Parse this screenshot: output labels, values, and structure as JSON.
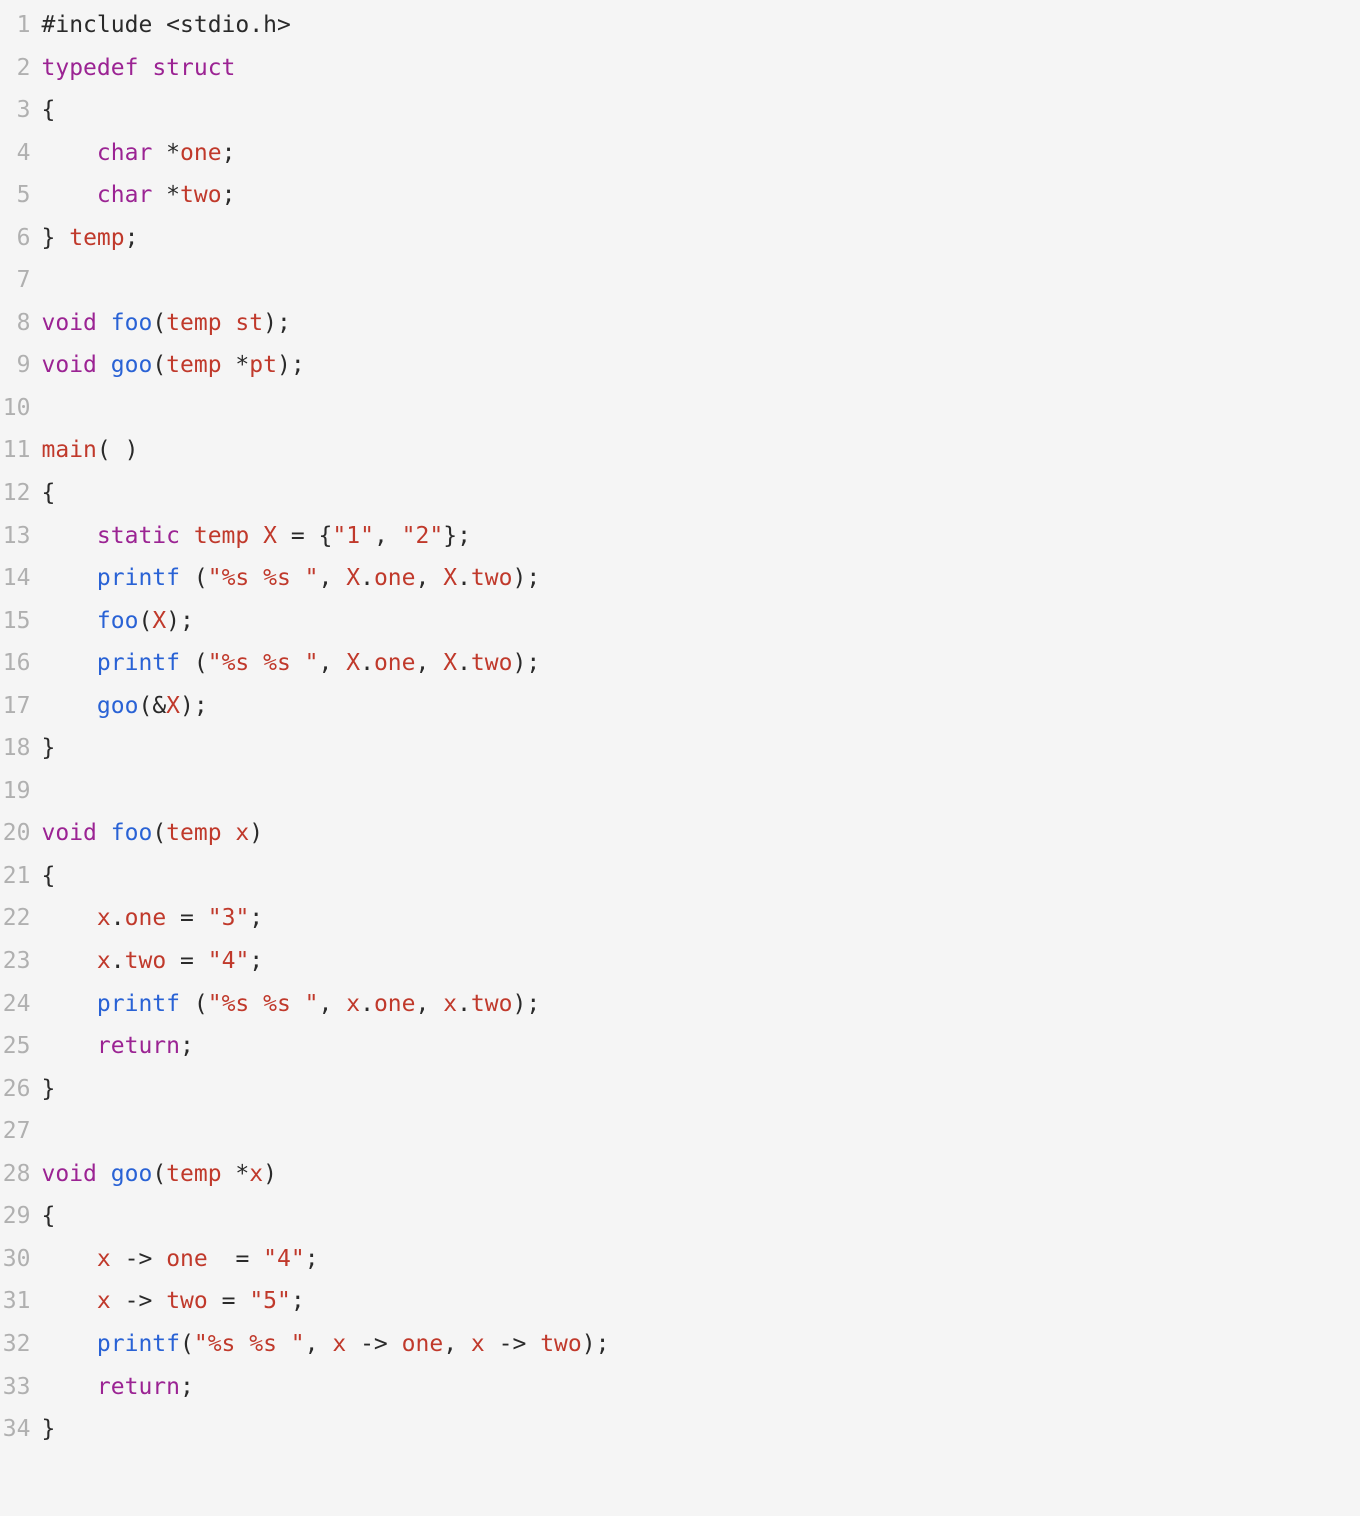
{
  "code": {
    "lines": [
      {
        "n": "1",
        "t": [
          [
            "preproc",
            "#include "
          ],
          [
            "op",
            "<"
          ],
          [
            "plain",
            "stdio.h"
          ],
          [
            "op",
            ">"
          ]
        ]
      },
      {
        "n": "2",
        "t": [
          [
            "keyword",
            "typedef"
          ],
          [
            "plain",
            " "
          ],
          [
            "keyword",
            "struct"
          ]
        ]
      },
      {
        "n": "3",
        "t": [
          [
            "op",
            "{"
          ]
        ]
      },
      {
        "n": "4",
        "t": [
          [
            "plain",
            "    "
          ],
          [
            "keyword",
            "char"
          ],
          [
            "plain",
            " "
          ],
          [
            "op",
            "*"
          ],
          [
            "ident",
            "one"
          ],
          [
            "op",
            ";"
          ]
        ]
      },
      {
        "n": "5",
        "t": [
          [
            "plain",
            "    "
          ],
          [
            "keyword",
            "char"
          ],
          [
            "plain",
            " "
          ],
          [
            "op",
            "*"
          ],
          [
            "ident",
            "two"
          ],
          [
            "op",
            ";"
          ]
        ]
      },
      {
        "n": "6",
        "t": [
          [
            "op",
            "}"
          ],
          [
            "plain",
            " "
          ],
          [
            "typename",
            "temp"
          ],
          [
            "op",
            ";"
          ]
        ]
      },
      {
        "n": "7",
        "t": []
      },
      {
        "n": "8",
        "t": [
          [
            "keyword",
            "void"
          ],
          [
            "plain",
            " "
          ],
          [
            "func",
            "foo"
          ],
          [
            "op",
            "("
          ],
          [
            "typename",
            "temp"
          ],
          [
            "plain",
            " "
          ],
          [
            "ident",
            "st"
          ],
          [
            "op",
            ");"
          ]
        ]
      },
      {
        "n": "9",
        "t": [
          [
            "keyword",
            "void"
          ],
          [
            "plain",
            " "
          ],
          [
            "func",
            "goo"
          ],
          [
            "op",
            "("
          ],
          [
            "typename",
            "temp"
          ],
          [
            "plain",
            " "
          ],
          [
            "op",
            "*"
          ],
          [
            "ident",
            "pt"
          ],
          [
            "op",
            ");"
          ]
        ]
      },
      {
        "n": "10",
        "t": []
      },
      {
        "n": "11",
        "t": [
          [
            "typename",
            "main"
          ],
          [
            "op",
            "("
          ],
          [
            "plain",
            " "
          ],
          [
            "op",
            ")"
          ]
        ]
      },
      {
        "n": "12",
        "t": [
          [
            "op",
            "{"
          ]
        ]
      },
      {
        "n": "13",
        "t": [
          [
            "plain",
            "    "
          ],
          [
            "keyword",
            "static"
          ],
          [
            "plain",
            " "
          ],
          [
            "typename",
            "temp"
          ],
          [
            "plain",
            " "
          ],
          [
            "ident",
            "X"
          ],
          [
            "plain",
            " "
          ],
          [
            "op",
            "="
          ],
          [
            "plain",
            " "
          ],
          [
            "op",
            "{"
          ],
          [
            "string",
            "\"1\""
          ],
          [
            "op",
            ","
          ],
          [
            "plain",
            " "
          ],
          [
            "string",
            "\"2\""
          ],
          [
            "op",
            "};"
          ]
        ]
      },
      {
        "n": "14",
        "t": [
          [
            "plain",
            "    "
          ],
          [
            "func",
            "printf"
          ],
          [
            "plain",
            " "
          ],
          [
            "op",
            "("
          ],
          [
            "string",
            "\"%s %s \""
          ],
          [
            "op",
            ","
          ],
          [
            "plain",
            " "
          ],
          [
            "ident",
            "X"
          ],
          [
            "op",
            "."
          ],
          [
            "member",
            "one"
          ],
          [
            "op",
            ","
          ],
          [
            "plain",
            " "
          ],
          [
            "ident",
            "X"
          ],
          [
            "op",
            "."
          ],
          [
            "member",
            "two"
          ],
          [
            "op",
            ");"
          ]
        ]
      },
      {
        "n": "15",
        "t": [
          [
            "plain",
            "    "
          ],
          [
            "func",
            "foo"
          ],
          [
            "op",
            "("
          ],
          [
            "ident",
            "X"
          ],
          [
            "op",
            ");"
          ]
        ]
      },
      {
        "n": "16",
        "t": [
          [
            "plain",
            "    "
          ],
          [
            "func",
            "printf"
          ],
          [
            "plain",
            " "
          ],
          [
            "op",
            "("
          ],
          [
            "string",
            "\"%s %s \""
          ],
          [
            "op",
            ","
          ],
          [
            "plain",
            " "
          ],
          [
            "ident",
            "X"
          ],
          [
            "op",
            "."
          ],
          [
            "member",
            "one"
          ],
          [
            "op",
            ","
          ],
          [
            "plain",
            " "
          ],
          [
            "ident",
            "X"
          ],
          [
            "op",
            "."
          ],
          [
            "member",
            "two"
          ],
          [
            "op",
            ");"
          ]
        ]
      },
      {
        "n": "17",
        "t": [
          [
            "plain",
            "    "
          ],
          [
            "func",
            "goo"
          ],
          [
            "op",
            "("
          ],
          [
            "op",
            "&"
          ],
          [
            "ident",
            "X"
          ],
          [
            "op",
            ");"
          ]
        ]
      },
      {
        "n": "18",
        "t": [
          [
            "op",
            "}"
          ]
        ]
      },
      {
        "n": "19",
        "t": []
      },
      {
        "n": "20",
        "t": [
          [
            "keyword",
            "void"
          ],
          [
            "plain",
            " "
          ],
          [
            "func",
            "foo"
          ],
          [
            "op",
            "("
          ],
          [
            "typename",
            "temp"
          ],
          [
            "plain",
            " "
          ],
          [
            "ident",
            "x"
          ],
          [
            "op",
            ")"
          ]
        ]
      },
      {
        "n": "21",
        "t": [
          [
            "op",
            "{"
          ]
        ]
      },
      {
        "n": "22",
        "t": [
          [
            "plain",
            "    "
          ],
          [
            "ident",
            "x"
          ],
          [
            "op",
            "."
          ],
          [
            "member",
            "one"
          ],
          [
            "plain",
            " "
          ],
          [
            "op",
            "="
          ],
          [
            "plain",
            " "
          ],
          [
            "string",
            "\"3\""
          ],
          [
            "op",
            ";"
          ]
        ]
      },
      {
        "n": "23",
        "t": [
          [
            "plain",
            "    "
          ],
          [
            "ident",
            "x"
          ],
          [
            "op",
            "."
          ],
          [
            "member",
            "two"
          ],
          [
            "plain",
            " "
          ],
          [
            "op",
            "="
          ],
          [
            "plain",
            " "
          ],
          [
            "string",
            "\"4\""
          ],
          [
            "op",
            ";"
          ]
        ]
      },
      {
        "n": "24",
        "t": [
          [
            "plain",
            "    "
          ],
          [
            "func",
            "printf"
          ],
          [
            "plain",
            " "
          ],
          [
            "op",
            "("
          ],
          [
            "string",
            "\"%s %s \""
          ],
          [
            "op",
            ","
          ],
          [
            "plain",
            " "
          ],
          [
            "ident",
            "x"
          ],
          [
            "op",
            "."
          ],
          [
            "member",
            "one"
          ],
          [
            "op",
            ","
          ],
          [
            "plain",
            " "
          ],
          [
            "ident",
            "x"
          ],
          [
            "op",
            "."
          ],
          [
            "member",
            "two"
          ],
          [
            "op",
            ");"
          ]
        ]
      },
      {
        "n": "25",
        "t": [
          [
            "plain",
            "    "
          ],
          [
            "keyword",
            "return"
          ],
          [
            "op",
            ";"
          ]
        ]
      },
      {
        "n": "26",
        "t": [
          [
            "op",
            "}"
          ]
        ]
      },
      {
        "n": "27",
        "t": []
      },
      {
        "n": "28",
        "t": [
          [
            "keyword",
            "void"
          ],
          [
            "plain",
            " "
          ],
          [
            "func",
            "goo"
          ],
          [
            "op",
            "("
          ],
          [
            "typename",
            "temp"
          ],
          [
            "plain",
            " "
          ],
          [
            "op",
            "*"
          ],
          [
            "ident",
            "x"
          ],
          [
            "op",
            ")"
          ]
        ]
      },
      {
        "n": "29",
        "t": [
          [
            "op",
            "{"
          ]
        ]
      },
      {
        "n": "30",
        "t": [
          [
            "plain",
            "    "
          ],
          [
            "ident",
            "x"
          ],
          [
            "plain",
            " "
          ],
          [
            "op",
            "->"
          ],
          [
            "plain",
            " "
          ],
          [
            "member",
            "one"
          ],
          [
            "plain",
            "  "
          ],
          [
            "op",
            "="
          ],
          [
            "plain",
            " "
          ],
          [
            "string",
            "\"4\""
          ],
          [
            "op",
            ";"
          ]
        ]
      },
      {
        "n": "31",
        "t": [
          [
            "plain",
            "    "
          ],
          [
            "ident",
            "x"
          ],
          [
            "plain",
            " "
          ],
          [
            "op",
            "->"
          ],
          [
            "plain",
            " "
          ],
          [
            "member",
            "two"
          ],
          [
            "plain",
            " "
          ],
          [
            "op",
            "="
          ],
          [
            "plain",
            " "
          ],
          [
            "string",
            "\"5\""
          ],
          [
            "op",
            ";"
          ]
        ]
      },
      {
        "n": "32",
        "t": [
          [
            "plain",
            "    "
          ],
          [
            "func",
            "printf"
          ],
          [
            "op",
            "("
          ],
          [
            "string",
            "\"%s %s \""
          ],
          [
            "op",
            ","
          ],
          [
            "plain",
            " "
          ],
          [
            "ident",
            "x"
          ],
          [
            "plain",
            " "
          ],
          [
            "op",
            "->"
          ],
          [
            "plain",
            " "
          ],
          [
            "member",
            "one"
          ],
          [
            "op",
            ","
          ],
          [
            "plain",
            " "
          ],
          [
            "ident",
            "x"
          ],
          [
            "plain",
            " "
          ],
          [
            "op",
            "->"
          ],
          [
            "plain",
            " "
          ],
          [
            "member",
            "two"
          ],
          [
            "op",
            ");"
          ]
        ]
      },
      {
        "n": "33",
        "t": [
          [
            "plain",
            "    "
          ],
          [
            "keyword",
            "return"
          ],
          [
            "op",
            ";"
          ]
        ]
      },
      {
        "n": "34",
        "t": [
          [
            "op",
            "}"
          ]
        ]
      }
    ]
  }
}
